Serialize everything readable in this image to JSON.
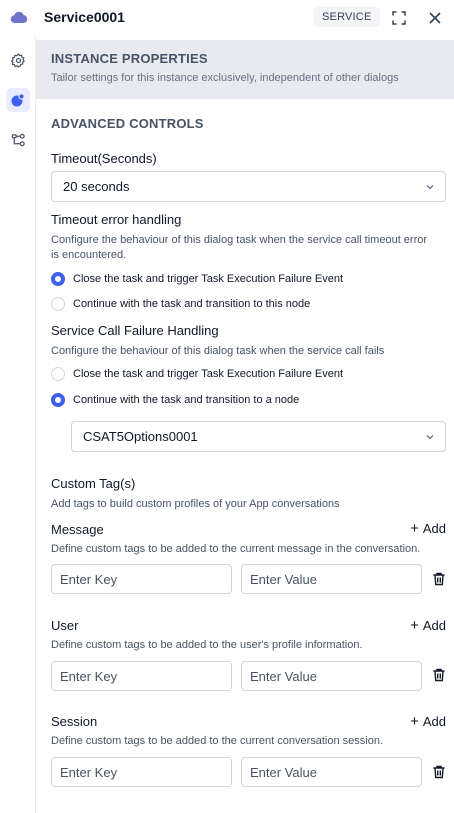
{
  "header": {
    "title": "Service0001",
    "badge": "SERVICE",
    "icons": {
      "app": "cloud-icon",
      "expand": "expand-icon",
      "close": "close-icon"
    }
  },
  "rail": {
    "items": [
      {
        "name": "settings",
        "icon": "gear-icon",
        "active": false
      },
      {
        "name": "instance",
        "icon": "instance-icon",
        "active": true
      },
      {
        "name": "connections",
        "icon": "connections-icon",
        "active": false
      }
    ]
  },
  "banner": {
    "title": "INSTANCE PROPERTIES",
    "subtitle": "Tailor settings for this instance exclusively, independent of other dialogs"
  },
  "advanced": {
    "title": "ADVANCED CONTROLS",
    "timeout_label": "Timeout(Seconds)",
    "timeout_value": "20 seconds",
    "timeout_error": {
      "label": "Timeout error handling",
      "help": "Configure the behaviour of this dialog task when the service call timeout error is encountered.",
      "options": [
        {
          "label": "Close the task and trigger Task Execution Failure Event",
          "selected": true
        },
        {
          "label": "Continue with the task and transition to this node",
          "selected": false
        }
      ]
    },
    "failure": {
      "label": "Service Call Failure Handling",
      "help": "Configure the behaviour of this dialog task when the service call fails",
      "options": [
        {
          "label": "Close the task and trigger Task Execution Failure Event",
          "selected": false
        },
        {
          "label": "Continue with the task and transition to a node",
          "selected": true
        }
      ],
      "node_value": "CSAT5Options0001"
    }
  },
  "tags": {
    "title": "Custom Tag(s)",
    "help": "Add tags to build custom profiles of your App conversations",
    "add_label": "Add",
    "key_placeholder": "Enter Key",
    "value_placeholder": "Enter Value",
    "groups": [
      {
        "label": "Message",
        "help": "Define custom tags to be added to the current message in the conversation."
      },
      {
        "label": "User",
        "help": "Define custom tags to be added to the user's profile information."
      },
      {
        "label": "Session",
        "help": "Define custom tags to be added to the current conversation session."
      }
    ]
  },
  "colors": {
    "accent": "#3f5ff0",
    "banner_bg": "#e8eaef",
    "border": "#d0d5dd",
    "rail_active": "#e9edff"
  }
}
